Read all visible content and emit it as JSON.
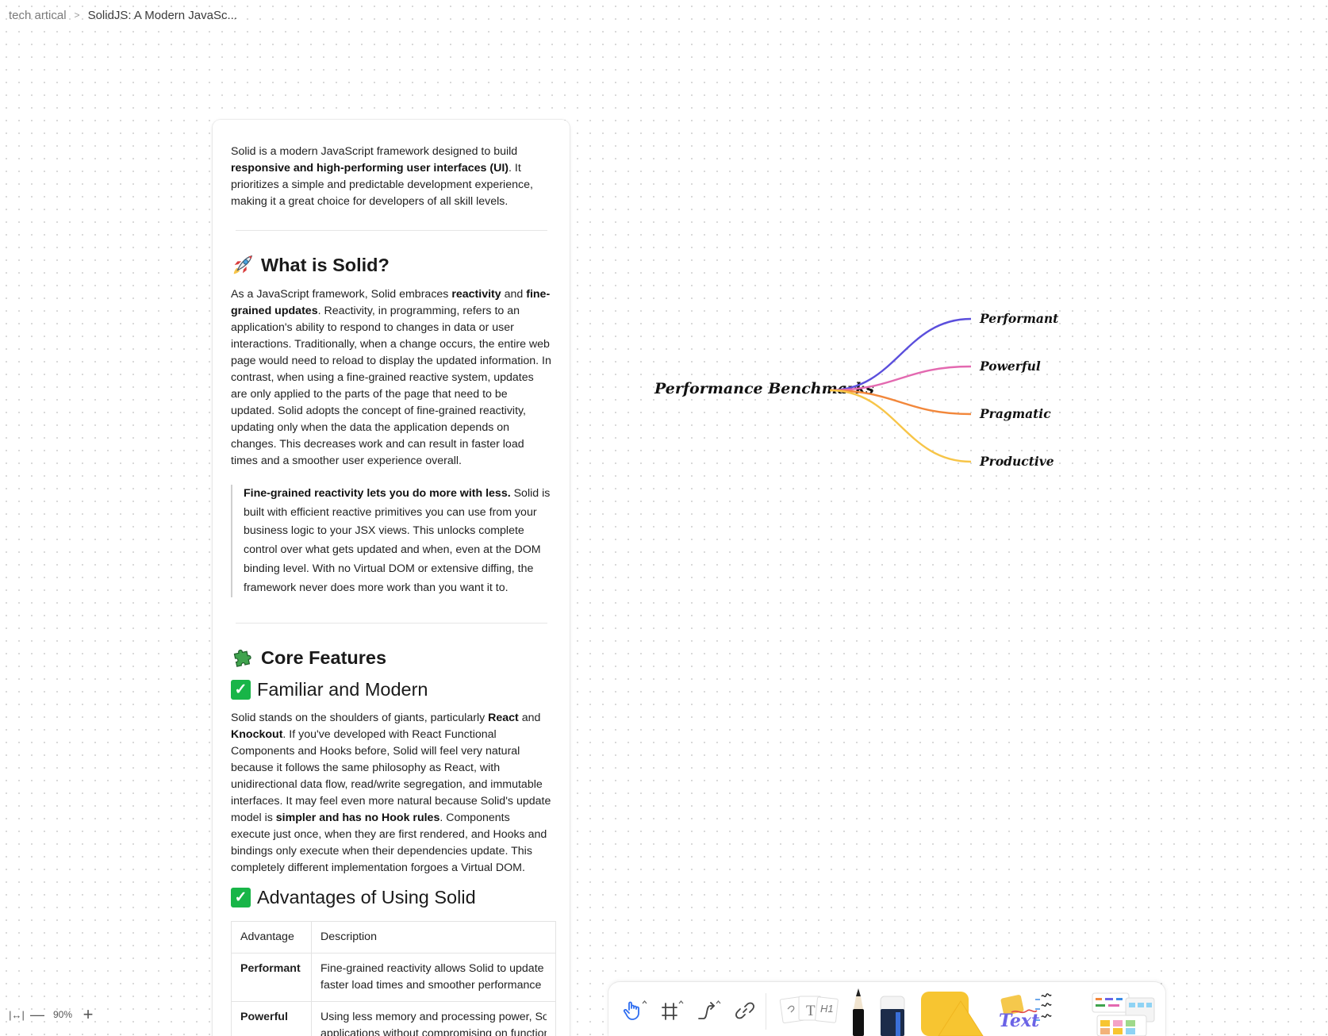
{
  "breadcrumb": {
    "parent": "tech artical",
    "separator": ">",
    "current": "SolidJS: A Modern JavaSc..."
  },
  "document": {
    "intro": {
      "t1": "Solid is a modern JavaScript framework designed to build ",
      "b1": "responsive and high-performing user interfaces (UI)",
      "t2": ". It prioritizes a simple and predictable development experience, making it a great choice for developers of all skill levels."
    },
    "what_is": {
      "heading": "What is Solid?",
      "t1": "As a JavaScript framework, Solid embraces ",
      "b1": "reactivity",
      "t2": " and ",
      "b2": "fine-grained updates",
      "t3": ". Reactivity, in programming, refers to an application's ability to respond to changes in data or user interactions. Traditionally, when a change occurs, the entire web page would need to reload to display the updated information. In contrast, when using a fine-grained reactive system, updates are only applied to the parts of the page that need to be updated. Solid adopts the concept of fine-grained reactivity, updating only when the data the application depends on changes. This decreases work and can result in faster load times and a smoother user experience overall."
    },
    "quote": {
      "b1": "Fine-grained reactivity lets you do more with less.",
      "t1": " Solid is built with efficient reactive primitives you can use from your business logic to your JSX views. This unlocks complete control over what gets updated and when, even at the DOM binding level. With no Virtual DOM or extensive diffing, the framework never does more work than you want it to."
    },
    "core_features": {
      "heading": "Core Features"
    },
    "familiar": {
      "heading": "Familiar and Modern",
      "t1": "Solid stands on the shoulders of giants, particularly ",
      "b1": "React",
      "t2": " and ",
      "b2": "Knockout",
      "t3": ". If you've developed with React Functional Components and Hooks before, Solid will feel very natural because it follows the same philosophy as React, with unidirectional data flow, read/write segregation, and immutable interfaces. It may feel even more natural because Solid's update model is ",
      "b3": "simpler and has no Hook rules",
      "t4": ". Components execute just once, when they are first rendered, and Hooks and bindings only execute when their dependencies update. This completely different implementation forgoes a Virtual DOM."
    },
    "advantages": {
      "heading": "Advantages of Using Solid",
      "table": {
        "col_advantage": "Advantage",
        "col_description": "Description",
        "rows": [
          {
            "name": "Performant",
            "l1": "Fine-grained reactivity allows Solid to update",
            "l2": "faster load times and smoother performance"
          },
          {
            "name": "Powerful",
            "l1": "Using less memory and processing power, Solid",
            "l2": "applications without compromising on functionality"
          }
        ]
      }
    }
  },
  "mindmap": {
    "root": "Performance Benchmarks",
    "branches": [
      {
        "label": "Performant",
        "color": "#5b4fdc"
      },
      {
        "label": "Powerful",
        "color": "#e369b0"
      },
      {
        "label": "Pragmatic",
        "color": "#f2873b"
      },
      {
        "label": "Productive",
        "color": "#f7c548"
      }
    ]
  },
  "zoom": {
    "fit_label": "|↔|",
    "minus": "—",
    "level": "90%",
    "plus": "+"
  },
  "toolbar": {
    "tools": [
      "hand-tool",
      "frame-tool",
      "connector-tool",
      "link-tool",
      "note-text-heading-tool",
      "pen-tool",
      "eraser-tool",
      "shape-tool",
      "text-scribble-tool",
      "template-tool"
    ],
    "note_heading_label": "H1",
    "note_text_label": "T",
    "scribble_text": "Text"
  }
}
